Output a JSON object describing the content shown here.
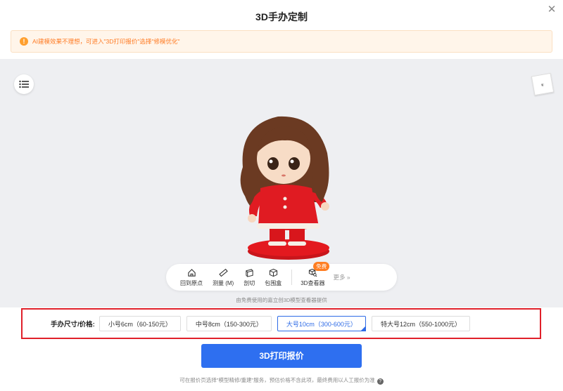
{
  "header": {
    "title": "3D手办定制",
    "close_icon": "close-icon"
  },
  "alert": {
    "text": "AI建模效果不理想，可进入\"3D打印报价\"选择\"修模优化\"",
    "icon": "warning-icon",
    "color": "#ff7a22"
  },
  "viewer": {
    "toolbar": {
      "items": [
        {
          "label": "回到原点",
          "icon": "home-icon"
        },
        {
          "label": "测量 (M)",
          "icon": "ruler-icon"
        },
        {
          "label": "剖切",
          "icon": "section-icon"
        },
        {
          "label": "包围盒",
          "icon": "box-icon"
        },
        {
          "label": "3D查看器",
          "icon": "viewer-icon",
          "badge": "免费"
        }
      ],
      "more_label": "更多 »"
    },
    "provider_text": "由免费使用的嘉立创3D模型查看器提供"
  },
  "size_selector": {
    "label": "手办尺寸/价格:",
    "options": [
      {
        "label": "小号6cm（60-150元）",
        "selected": false
      },
      {
        "label": "中号8cm（150-300元）",
        "selected": false
      },
      {
        "label": "大号10cm（300-600元）",
        "selected": true
      },
      {
        "label": "特大号12cm（550-1000元）",
        "selected": false
      }
    ]
  },
  "quote_button": "3D打印报价",
  "footer_text": "可在报价页选择\"模型精修/重建\"服务，预估价格不含此项，最终费用以人工报价为准",
  "colors": {
    "accent": "#2e6ff0",
    "highlight_border": "#e0202a",
    "badge": "#ff7d21"
  }
}
